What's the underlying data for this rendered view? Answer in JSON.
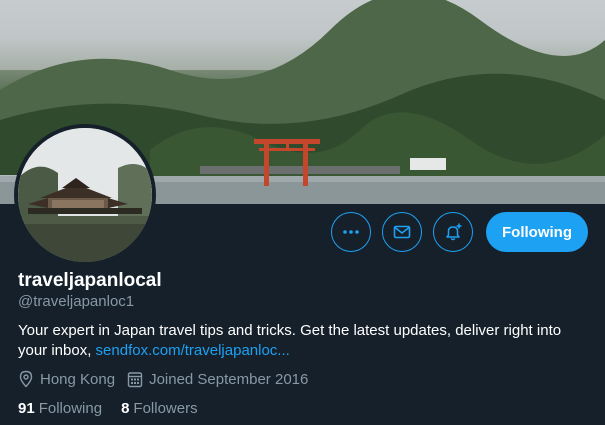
{
  "profile": {
    "display_name": "traveljapanlocal",
    "handle": "@traveljapanloc1",
    "bio_text": "Your expert in Japan travel tips and tricks. Get the latest updates, deliver right into your inbox, ",
    "bio_link": "sendfox.com/traveljapanloc...",
    "location": "Hong Kong",
    "joined": "Joined September 2016"
  },
  "stats": {
    "following_count": "91",
    "following_label": "Following",
    "followers_count": "8",
    "followers_label": "Followers"
  },
  "actions": {
    "more_icon": "more-icon",
    "message_icon": "envelope-icon",
    "notify_icon": "bell-plus-icon",
    "follow_label": "Following"
  },
  "colors": {
    "background": "#15202b",
    "accent": "#1da1f2",
    "secondary_text": "#8899a6"
  }
}
